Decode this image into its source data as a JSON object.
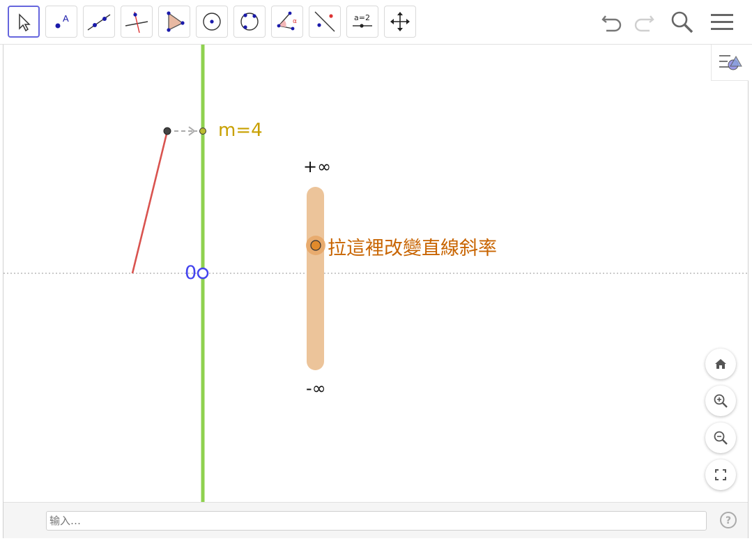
{
  "toolbar": {
    "tools": [
      {
        "name": "move-tool",
        "selected": true
      },
      {
        "name": "point-tool",
        "label": "A"
      },
      {
        "name": "line-tool"
      },
      {
        "name": "perpendicular-line-tool"
      },
      {
        "name": "polygon-tool"
      },
      {
        "name": "circle-center-point-tool"
      },
      {
        "name": "circle-three-points-tool"
      },
      {
        "name": "angle-tool",
        "label": "α"
      },
      {
        "name": "reflect-about-line-tool"
      },
      {
        "name": "slider-tool",
        "label": "a = 2"
      },
      {
        "name": "move-graphics-view-tool"
      }
    ],
    "actions": [
      "undo-icon",
      "redo-icon",
      "search-icon",
      "menu-icon"
    ]
  },
  "graphics": {
    "slope_label": "m=4",
    "slope_value": 4,
    "plus_infinity_label": "+∞",
    "minus_infinity_label": "-∞",
    "origin_label": "0",
    "drag_hint": "拉這裡改變直線斜率"
  },
  "colors": {
    "line_green": "#8fd14f",
    "segment_red": "#d9534f",
    "slider_track": "#ecc49a",
    "slider_handle": "#e08a2c",
    "drag_text": "#c86400",
    "m_label": "#c8a000",
    "origin_blue": "#4444ee",
    "selected_border": "#6666dd"
  },
  "view_controls": [
    "home-icon",
    "zoom-in-icon",
    "zoom-out-icon",
    "fullscreen-icon"
  ],
  "input": {
    "placeholder": "输入…"
  },
  "help": "help-icon"
}
